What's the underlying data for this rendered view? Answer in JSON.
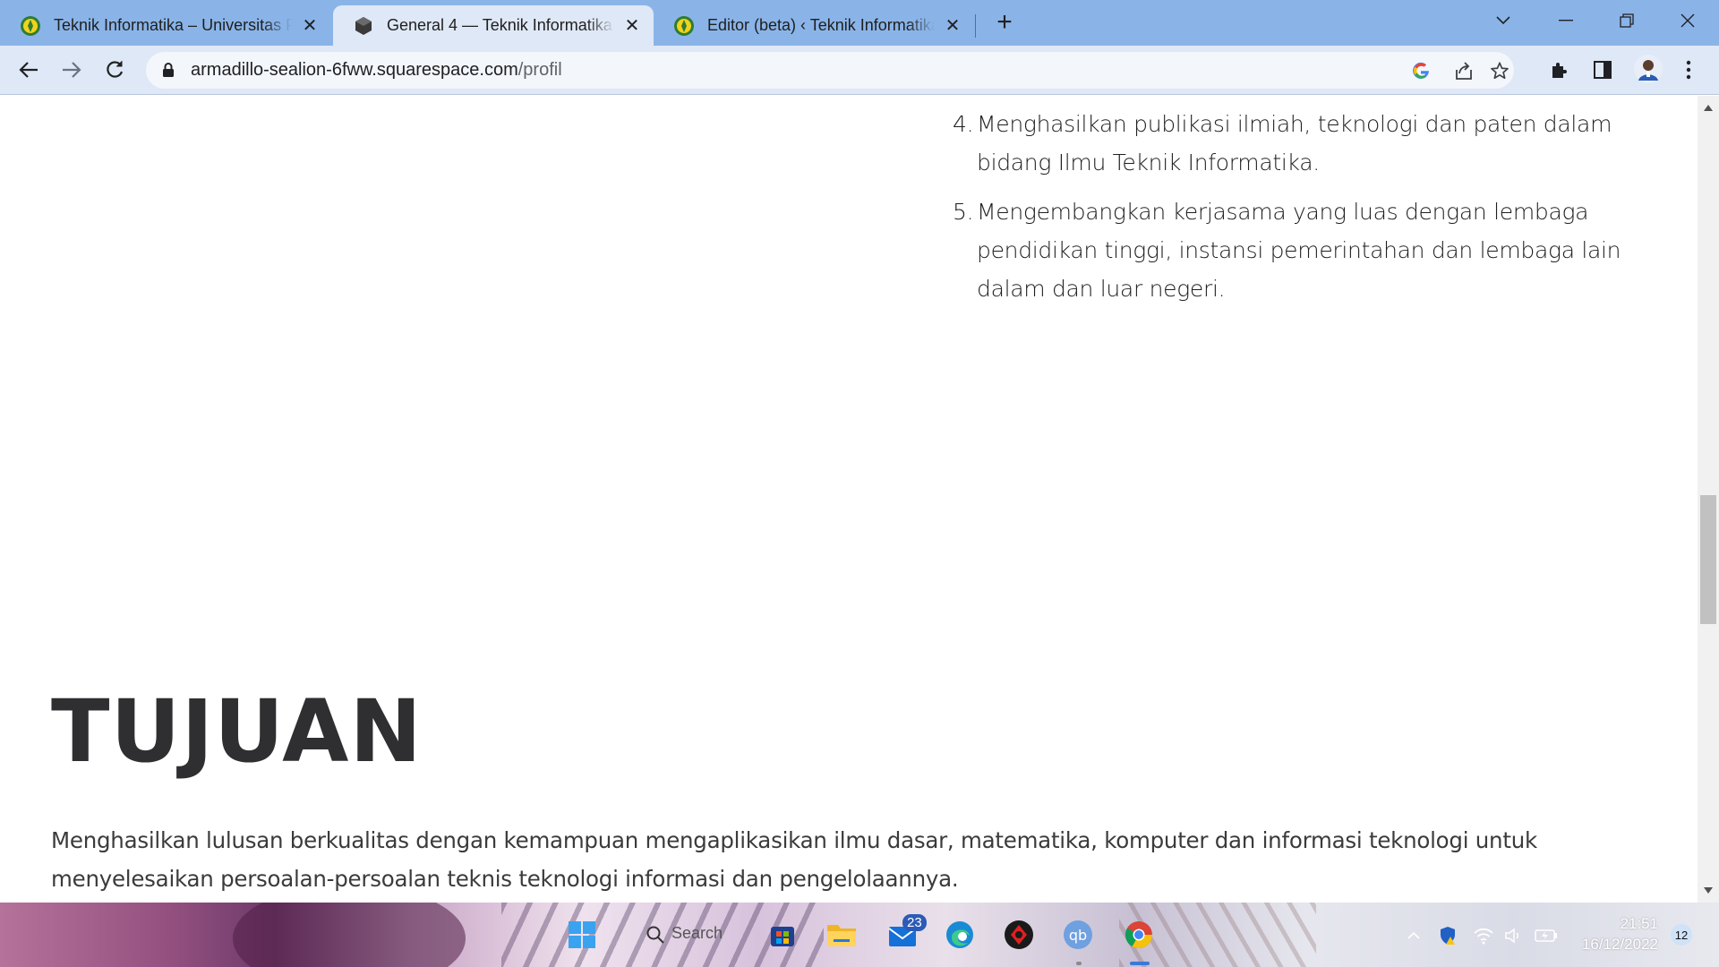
{
  "browser": {
    "tabs": [
      {
        "title": "Teknik Informatika – Universitas P",
        "active": false
      },
      {
        "title": "General 4 — Teknik Informatika U",
        "active": true
      },
      {
        "title": "Editor (beta) ‹ Teknik Informatika",
        "active": false
      }
    ],
    "tab_close_glyph": "✕",
    "new_tab_glyph": "+",
    "address": {
      "host": "armadillo-sealion-6fww.squarespace.com",
      "path": "/profil"
    }
  },
  "page": {
    "misi_items": [
      {
        "number": "4.",
        "text": "Menghasilkan publikasi ilmiah, teknologi dan paten dalam bidang Ilmu Teknik Informatika."
      },
      {
        "number": "5.",
        "text": "Mengembangkan kerjasama yang luas dengan lembaga pendidikan tinggi, instansi pemerintahan dan lembaga lain dalam dan luar negeri."
      }
    ],
    "heading": "TUJUAN",
    "body": "Menghasilkan lulusan berkualitas dengan kemampuan mengaplikasikan ilmu dasar, matematika, komputer dan informasi teknologi untuk menyelesaikan persoalan-persoalan teknis teknologi informasi dan pengelolaannya."
  },
  "taskbar": {
    "search_label": "Search",
    "mail_badge": "23",
    "time": "21:51",
    "date": "16/12/2022",
    "notification_count": "12"
  },
  "colors": {
    "titlebar": "#8ab4e8",
    "active_tab": "#dfe8f6",
    "heading": "#2f2f31"
  }
}
